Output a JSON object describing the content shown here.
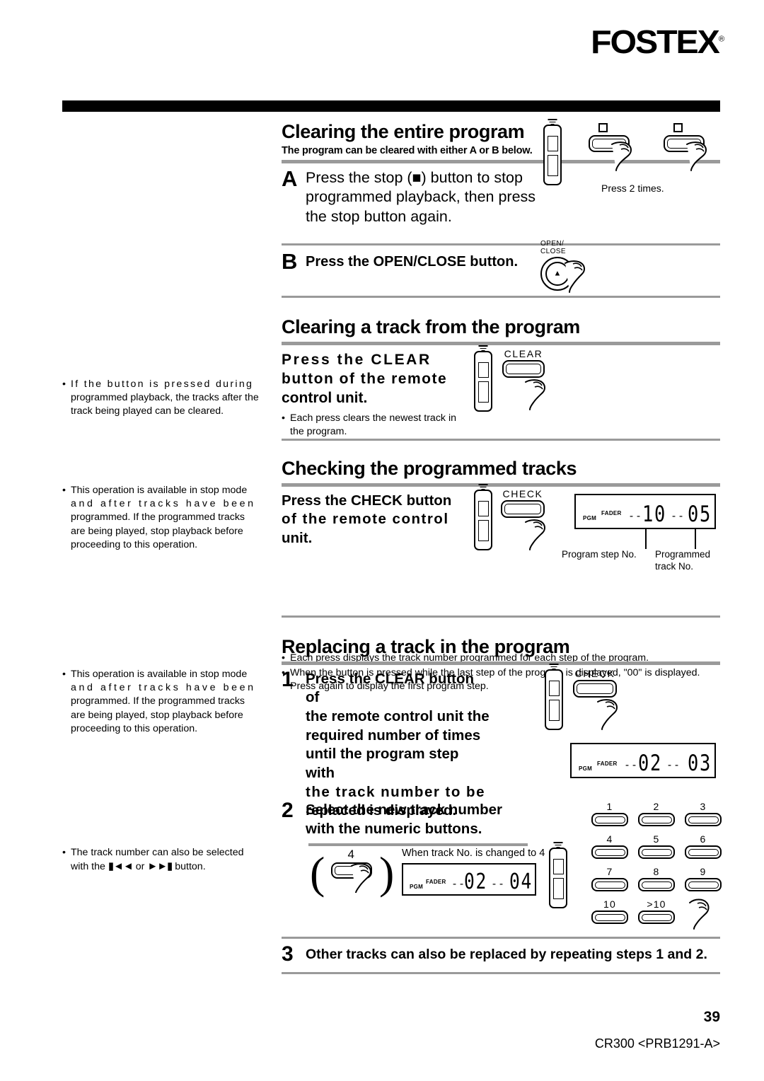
{
  "brand": {
    "name": "FOSTEX",
    "registered": "®"
  },
  "sections": [
    {
      "id": "clearing-entire-program",
      "title": "Clearing the entire program",
      "lead": "The program can be cleared with either A or B below.",
      "steps": [
        {
          "marker": "A",
          "lines": [
            "Press the stop (■) button to stop",
            "programmed playback, then press",
            "the stop button again."
          ],
          "caption": "Press 2 times."
        },
        {
          "marker": "B",
          "lines": [
            "Press the OPEN/CLOSE button."
          ],
          "button_label_top": "OPEN/",
          "button_label_bottom": "CLOSE",
          "eject_glyph": "▲"
        }
      ]
    },
    {
      "id": "clearing-a-track",
      "title": "Clearing a track from the program",
      "instruction_lines": [
        "Press the CLEAR",
        "button of the remote",
        "control unit."
      ],
      "button_label": "CLEAR",
      "bullets": [
        "Each press clears the newest track in the program."
      ],
      "margin_note": "If the button is pressed during programmed playback, the tracks after the track being played can be cleared.",
      "margin_note_line1": "If  the  button  is  pressed  during",
      "margin_note_line2": "programmed playback, the tracks after",
      "margin_note_line3": "the track being played can be cleared."
    },
    {
      "id": "checking-programmed-tracks",
      "title": "Checking the programmed tracks",
      "instruction_lines": [
        "Press the CHECK button",
        "of the remote control",
        "unit."
      ],
      "button_label": "CHECK",
      "display": {
        "pgm_label": "PGM",
        "fader_label": "FADER",
        "left_dashes": "--",
        "left_value": "10",
        "right_dashes": "--",
        "right_value": "05"
      },
      "callouts": {
        "left": "Program step No.",
        "right_line1": "Programmed",
        "right_line2": "track No."
      },
      "bullets": [
        "Each press displays the track number programmed for each step of the program.",
        "When the button is pressed while the last step of the program is displayed, \"00\" is displayed. Press again to display the first program step."
      ],
      "margin_note_line1": "This operation is available in stop mode",
      "margin_note_line2": "and  after  tracks  have  been",
      "margin_note_line3": "programmed. If the programmed tracks",
      "margin_note_line4": "are being played, stop playback before",
      "margin_note_line5": "proceeding to this operation."
    },
    {
      "id": "replacing-a-track",
      "title": "Replacing a track in the program",
      "steps": [
        {
          "marker": "1",
          "lines": [
            "Press the CLEAR button of",
            "the remote control unit the",
            "required number of times",
            "until the program step with",
            "the track number to be",
            "replaced is displayed."
          ],
          "button_label": "CHECK",
          "display": {
            "pgm_label": "PGM",
            "fader_label": "FADER",
            "left_dashes": "--",
            "left_value": "02",
            "right_value": "03"
          },
          "margin_note_line1": "This operation is available in stop mode",
          "margin_note_line2": "and  after  tracks  have  been",
          "margin_note_line3": "programmed. If the programmed tracks",
          "margin_note_line4": "are being played, stop playback before",
          "margin_note_line5": "proceeding to this operation."
        },
        {
          "marker": "2",
          "lines": [
            "Select the new track number",
            "with the numeric buttons."
          ],
          "inset_key": "4",
          "inset_caption": "When track No. is changed to 4",
          "display": {
            "pgm_label": "PGM",
            "fader_label": "FADER",
            "left_dashes": "--",
            "left_value": "02",
            "right_value": "04"
          },
          "keypad": [
            "1",
            "2",
            "3",
            "4",
            "5",
            "6",
            "7",
            "8",
            "9",
            "10",
            ">10"
          ],
          "margin_note_line1": "The track number can also be selected",
          "margin_note_line2_pre": "with the",
          "margin_note_skip_back": "⏮",
          "margin_note_or": "or",
          "margin_note_skip_fwd": "⏭",
          "margin_note_line2_post": "button."
        },
        {
          "marker": "3",
          "lines": [
            "Other tracks can also be replaced by repeating steps 1 and 2."
          ]
        }
      ]
    }
  ],
  "footer": {
    "page_number": "39",
    "model_code": "CR300 <PRB1291-A>"
  }
}
